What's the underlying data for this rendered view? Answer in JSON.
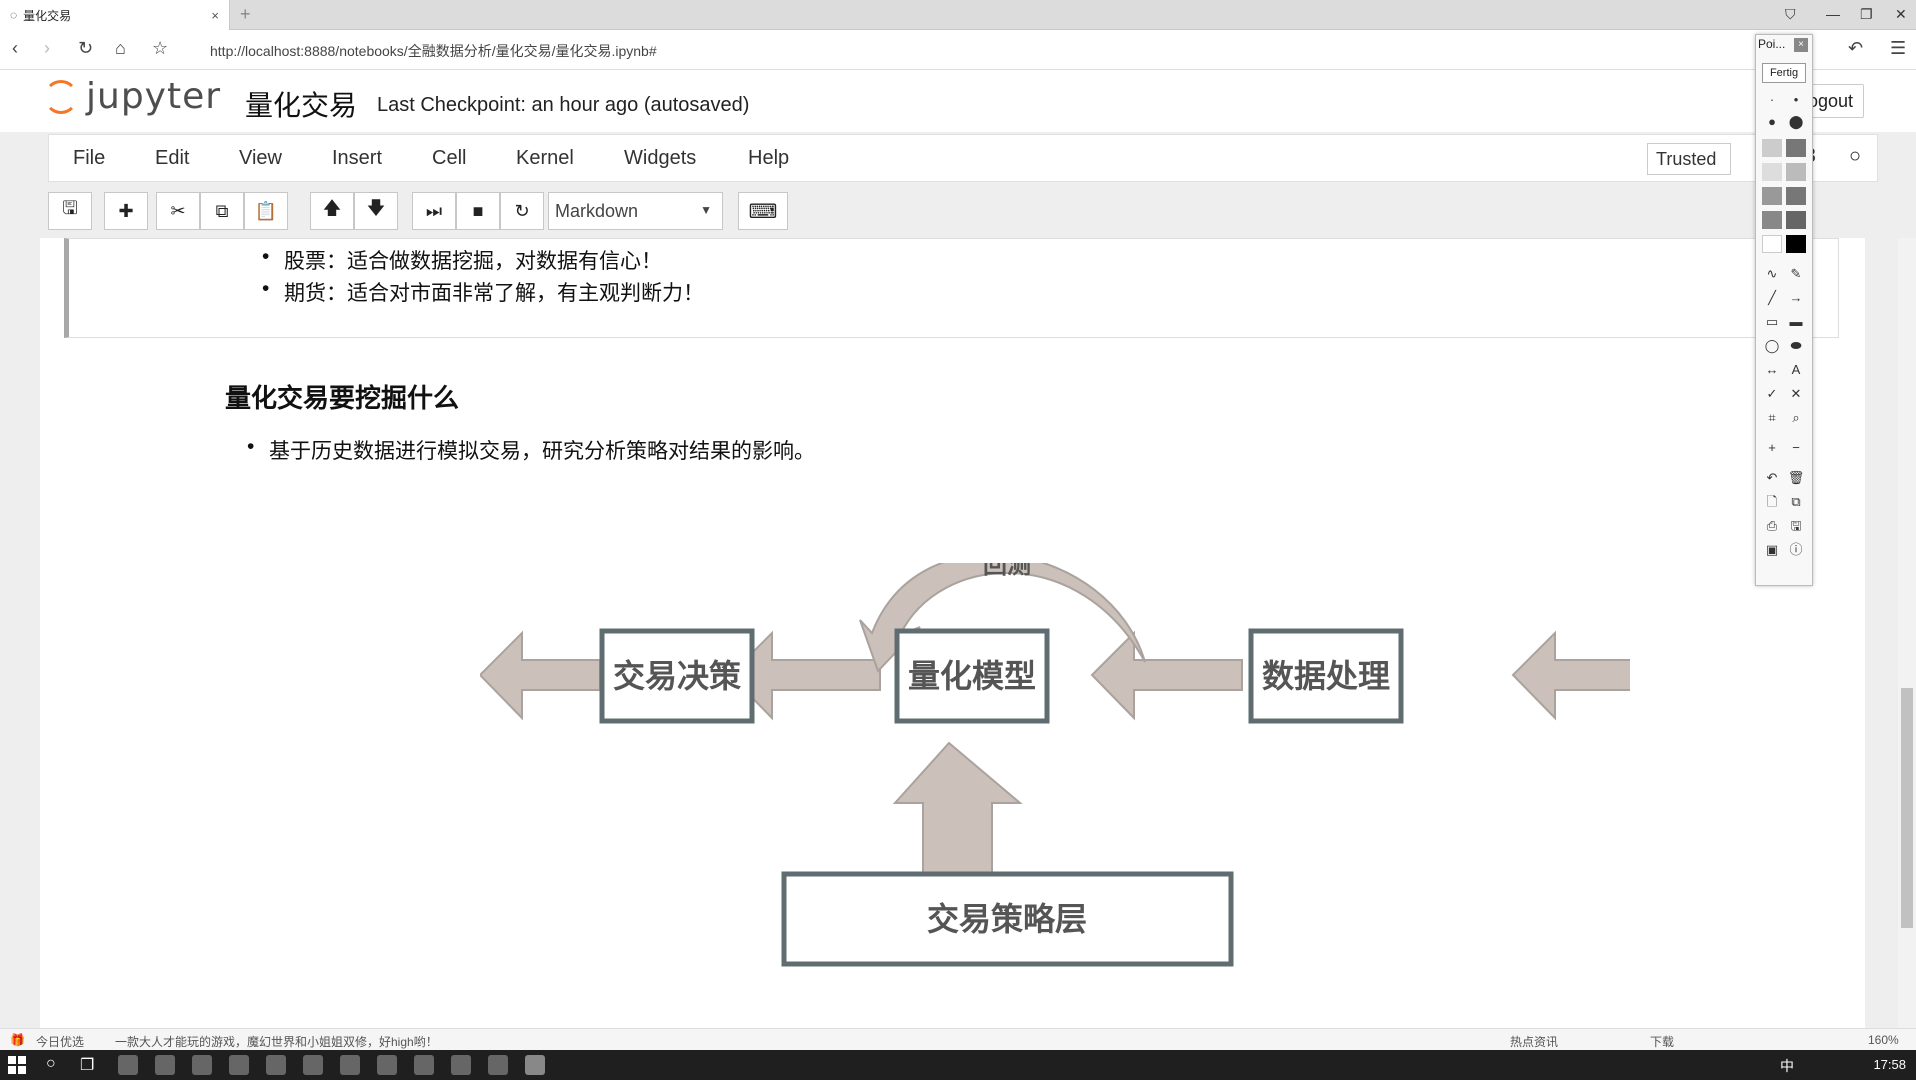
{
  "browser": {
    "tab_title": "量化交易",
    "tab_close": "×",
    "new_tab": "+",
    "url": "http://localhost:8888/notebooks/全融数据分析/量化交易/量化交易.ipynb#"
  },
  "jupyter": {
    "logo_text": "jupyter",
    "notebook_title": "量化交易",
    "checkpoint": "Last Checkpoint: an hour ago (autosaved)",
    "logout_label": "ogout"
  },
  "menubar": {
    "items": [
      "File",
      "Edit",
      "View",
      "Insert",
      "Cell",
      "Kernel",
      "Widgets",
      "Help"
    ],
    "trusted_label": "Trusted",
    "kernel_indicator": "F        3"
  },
  "toolbar": {
    "cell_type": "Markdown"
  },
  "notebook": {
    "prev_bullets": [
      "股票：适合做数据挖掘，对数据有信心！",
      "期货：适合对市面非常了解，有主观判断力！"
    ],
    "section_title": "量化交易要挖掘什么",
    "section_bullets": [
      "基于历史数据进行模拟交易，研究分析策略对结果的影响。"
    ]
  },
  "diagram": {
    "loop_label": "回测",
    "box_decision": "交易决策",
    "box_model": "量化模型",
    "box_data": "数据处理",
    "box_strategy": "交易策略层"
  },
  "palette": {
    "title": "Poi...",
    "done_button": "Fertig"
  },
  "statusbar": {
    "left_label": "今日优选",
    "news": "一款大人才能玩的游戏，魔幻世界和小姐姐双修，好high哟！",
    "hot_news": "热点资讯",
    "download": "下载",
    "zoom": "160%"
  },
  "taskbar": {
    "lang": "中",
    "time": "17:58"
  },
  "colors": {
    "arrow_fill": "#cbc0ba",
    "arrow_stroke": "#aaa29d",
    "box_border": "#5f6c70",
    "jupyter_orange": "#f37726"
  }
}
